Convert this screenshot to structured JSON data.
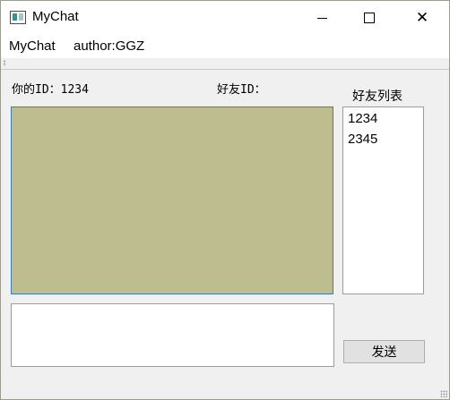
{
  "window": {
    "title": "MyChat",
    "icon": "app-window-icon",
    "controls": {
      "minimize": "minimize-icon",
      "maximize": "maximize-icon",
      "close": "close-icon",
      "close_glyph": "✕"
    }
  },
  "menubar": {
    "items": [
      "MyChat",
      "author:GGZ"
    ]
  },
  "labels": {
    "your_id": "你的ID：1234",
    "friend_id": "好友ID：",
    "friend_list": "好友列表"
  },
  "friend_list": {
    "items": [
      "1234",
      "2345"
    ]
  },
  "chat_display": {
    "background_color": "#bdbd8f"
  },
  "message_input": {
    "value": ""
  },
  "send_button": {
    "label": "发送"
  }
}
